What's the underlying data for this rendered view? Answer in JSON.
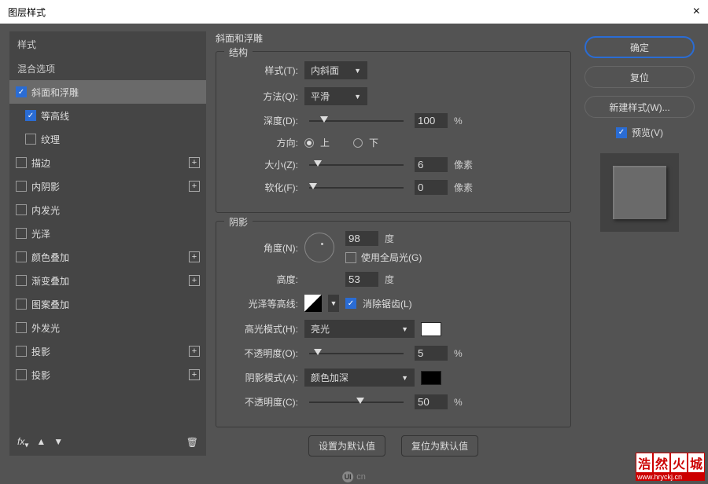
{
  "title": "图层样式",
  "left": {
    "styles_label": "样式",
    "blend_label": "混合选项",
    "items": [
      {
        "label": "斜面和浮雕",
        "checked": true,
        "selected": true,
        "plus": false,
        "sub": false
      },
      {
        "label": "等高线",
        "checked": true,
        "selected": false,
        "plus": false,
        "sub": true
      },
      {
        "label": "纹理",
        "checked": false,
        "selected": false,
        "plus": false,
        "sub": true
      },
      {
        "label": "描边",
        "checked": false,
        "selected": false,
        "plus": true,
        "sub": false
      },
      {
        "label": "内阴影",
        "checked": false,
        "selected": false,
        "plus": true,
        "sub": false
      },
      {
        "label": "内发光",
        "checked": false,
        "selected": false,
        "plus": false,
        "sub": false
      },
      {
        "label": "光泽",
        "checked": false,
        "selected": false,
        "plus": false,
        "sub": false
      },
      {
        "label": "颜色叠加",
        "checked": false,
        "selected": false,
        "plus": true,
        "sub": false
      },
      {
        "label": "渐变叠加",
        "checked": false,
        "selected": false,
        "plus": true,
        "sub": false
      },
      {
        "label": "图案叠加",
        "checked": false,
        "selected": false,
        "plus": false,
        "sub": false
      },
      {
        "label": "外发光",
        "checked": false,
        "selected": false,
        "plus": false,
        "sub": false
      },
      {
        "label": "投影",
        "checked": false,
        "selected": false,
        "plus": true,
        "sub": false
      },
      {
        "label": "投影",
        "checked": false,
        "selected": false,
        "plus": true,
        "sub": false
      }
    ],
    "fx_label": "fx"
  },
  "center": {
    "title": "斜面和浮雕",
    "structure": {
      "legend": "结构",
      "style_label": "样式(T):",
      "style_value": "内斜面",
      "method_label": "方法(Q):",
      "method_value": "平滑",
      "depth_label": "深度(D):",
      "depth_value": "100",
      "depth_unit": "%",
      "direction_label": "方向:",
      "dir_up": "上",
      "dir_down": "下",
      "size_label": "大小(Z):",
      "size_value": "6",
      "size_unit": "像素",
      "soften_label": "软化(F):",
      "soften_value": "0",
      "soften_unit": "像素"
    },
    "shadow": {
      "legend": "阴影",
      "angle_label": "角度(N):",
      "angle_value": "98",
      "angle_unit": "度",
      "global_label": "使用全局光(G)",
      "altitude_label": "高度:",
      "altitude_value": "53",
      "altitude_unit": "度",
      "contour_label": "光泽等高线:",
      "antialias_label": "消除锯齿(L)",
      "highlight_mode_label": "高光模式(H):",
      "highlight_mode_value": "亮光",
      "highlight_color": "#ffffff",
      "highlight_opacity_label": "不透明度(O):",
      "highlight_opacity_value": "5",
      "highlight_opacity_unit": "%",
      "shadow_mode_label": "阴影模式(A):",
      "shadow_mode_value": "颜色加深",
      "shadow_color": "#000000",
      "shadow_opacity_label": "不透明度(C):",
      "shadow_opacity_value": "50",
      "shadow_opacity_unit": "%"
    },
    "default_btn": "设置为默认值",
    "reset_btn": "复位为默认值"
  },
  "right": {
    "ok": "确定",
    "cancel": "复位",
    "new_style": "新建样式(W)...",
    "preview": "预览(V)"
  },
  "watermark": {
    "chars": [
      "浩",
      "然",
      "火",
      "城"
    ],
    "url": "www.hryckj.cn"
  },
  "uicn": "cn"
}
